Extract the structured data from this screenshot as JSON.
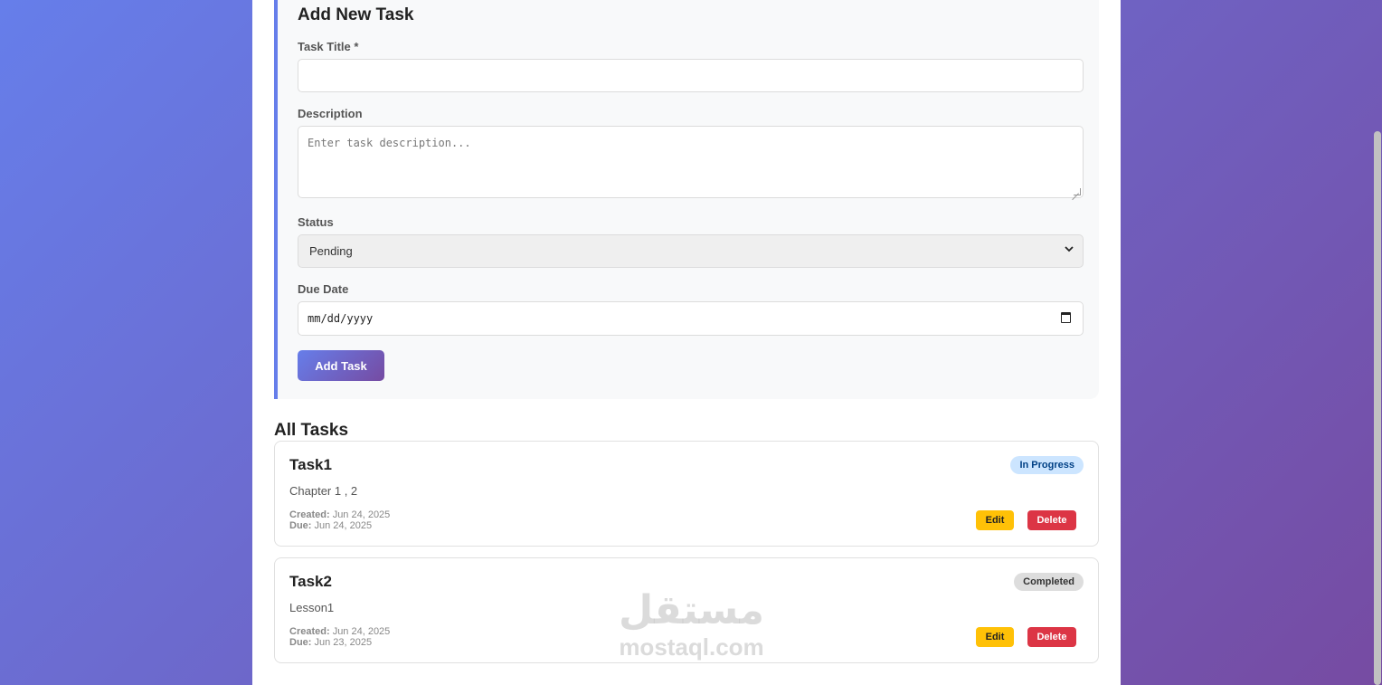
{
  "form": {
    "title": "Add New Task",
    "task_title_label": "Task Title *",
    "task_title_value": "",
    "description_label": "Description",
    "description_placeholder": "Enter task description...",
    "status_label": "Status",
    "status_value": "Pending",
    "due_date_label": "Due Date",
    "due_date_placeholder": "mm/dd/yyyy",
    "submit_label": "Add Task"
  },
  "tasks_section": {
    "title": "All Tasks",
    "tasks": [
      {
        "name": "Task1",
        "description": "Chapter 1 , 2",
        "status": "In Progress",
        "created_label": "Created:",
        "created": "Jun 24, 2025",
        "due_label": "Due:",
        "due": "Jun 24, 2025",
        "edit_label": "Edit",
        "delete_label": "Delete"
      },
      {
        "name": "Task2",
        "description": "Lesson1",
        "status": "Completed",
        "created_label": "Created:",
        "created": "Jun 24, 2025",
        "due_label": "Due:",
        "due": "Jun 23, 2025",
        "edit_label": "Edit",
        "delete_label": "Delete"
      }
    ]
  },
  "watermark": {
    "arabic": "مستقل",
    "latin": "mostaql.com"
  },
  "colors": {
    "background_start": "#667eea",
    "background_end": "#764ba2",
    "in_progress_badge": "#cce5ff",
    "completed_badge": "#dddddd",
    "edit_button": "#ffc107",
    "delete_button": "#dc3545"
  },
  "icons": {
    "select": "chevron-down-icon",
    "date": "calendar-icon"
  }
}
